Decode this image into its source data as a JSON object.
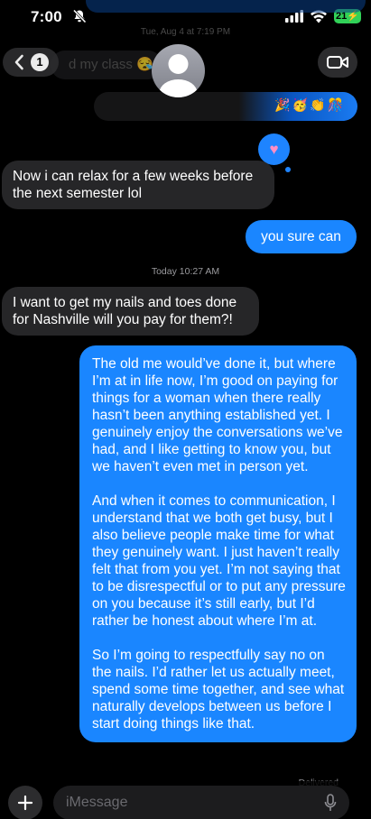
{
  "status_bar": {
    "time": "7:00",
    "battery": "21",
    "icons": [
      "bell-slash-icon",
      "cellular-signal-icon",
      "wifi-icon",
      "battery-icon"
    ]
  },
  "header": {
    "back_count": "1",
    "icons": [
      "chevron-left-icon",
      "contact-avatar",
      "video-camera-icon"
    ]
  },
  "background": {
    "date_label": "Tue, Aug 4 at 7:19 PM",
    "class_fragment": "d my class 😪",
    "emoji_fragment": "🎉🥳👏🎊"
  },
  "tapback": {
    "reaction": "♥",
    "icon": "heart-reaction-icon"
  },
  "conversation": {
    "timestamp": "Today 10:27 AM",
    "messages": [
      {
        "from": "them",
        "text": "Now i can relax for a few weeks before the next semester lol"
      },
      {
        "from": "me",
        "text": "you sure can"
      },
      {
        "from": "them",
        "text": "I want to get my nails and toes done for Nashville will you pay for them?!"
      },
      {
        "from": "me",
        "paragraphs": [
          "The old me would’ve done it, but where I’m at in life now, I’m good on paying for things for a woman when there really hasn’t been anything established yet. I genuinely enjoy the conversations we’ve had, and I like getting to know you, but we haven’t even met in person yet.",
          "And when it comes to communication, I understand that we both get busy, but I also believe people make time for what they genuinely want. I just haven’t really felt that from you yet. I’m not saying that to be disrespectful or to put any pressure on you because it’s still early, but I’d rather be honest about where I’m at.",
          "So I’m going to respectfully say no on the nails. I’d rather let us actually meet, spend some time together, and see what naturally develops between us before I start doing things like that."
        ]
      }
    ],
    "delivered": "Delivered"
  },
  "composer": {
    "placeholder": "iMessage",
    "icons": [
      "plus-icon",
      "microphone-icon"
    ]
  },
  "colors": {
    "sent_bubble": "#1a86ff",
    "received_bubble": "#262628",
    "background": "#000000",
    "battery": "#31d158"
  }
}
